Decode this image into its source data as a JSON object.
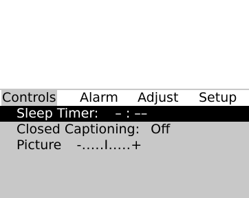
{
  "menu": {
    "tabs": [
      {
        "label": "Controls",
        "active": true
      },
      {
        "label": "Alarm",
        "active": false
      },
      {
        "label": "Adjust",
        "active": false
      },
      {
        "label": "Setup",
        "active": false
      }
    ],
    "items": [
      {
        "label": "Sleep Timer:",
        "value": "– : ––",
        "selected": true
      },
      {
        "label": "Closed Captioning:",
        "value": "Off",
        "selected": false
      },
      {
        "label": "Picture",
        "value": "-.....I.....+",
        "selected": false
      }
    ]
  },
  "colors": {
    "panel": "#c8c8c8",
    "highlight": "#000000",
    "highlight_text": "#ffffff",
    "background": "#ffffff"
  }
}
